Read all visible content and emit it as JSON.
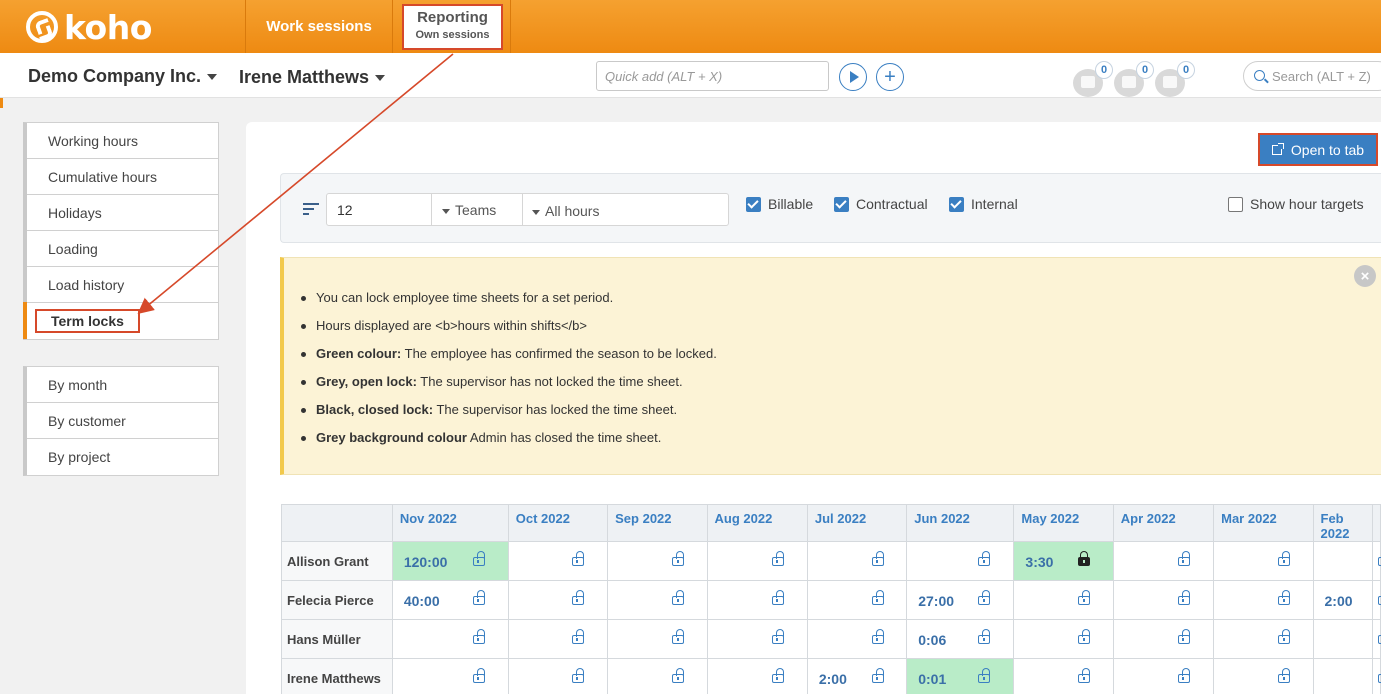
{
  "app": {
    "brand": "koho",
    "nav": {
      "work_sessions": "Work sessions",
      "reporting": "Reporting",
      "reporting_sub": "Own sessions"
    }
  },
  "subbar": {
    "company": "Demo Company Inc.",
    "person": "Irene Matthews",
    "quick_add_placeholder": "Quick add (ALT + X)",
    "notifications": [
      "0",
      "0",
      "0"
    ],
    "search_placeholder": "Search (ALT + Z)"
  },
  "sidebar": {
    "group1": [
      "Working hours",
      "Cumulative hours",
      "Holidays",
      "Loading",
      "Load history",
      "Term locks"
    ],
    "group2": [
      "By month",
      "By customer",
      "By project"
    ]
  },
  "toolbar": {
    "open_to_tab": "Open to tab",
    "count": "12",
    "teams": "Teams",
    "hours": "All hours",
    "checkboxes": {
      "billable": "Billable",
      "contractual": "Contractual",
      "internal": "Internal",
      "show_targets": "Show hour targets"
    }
  },
  "info": {
    "close": "×",
    "items": [
      {
        "bold": "",
        "text": "You can lock employee time sheets for a set period."
      },
      {
        "bold": "",
        "text": "Hours displayed are <b>hours within shifts</b>"
      },
      {
        "bold": "Green colour:",
        "text": " The employee has confirmed the season to be locked."
      },
      {
        "bold": "Grey, open lock:",
        "text": " The supervisor has not locked the time sheet."
      },
      {
        "bold": "Black, closed lock:",
        "text": " The supervisor has locked the time sheet."
      },
      {
        "bold": "Grey background colour",
        "text": " Admin has closed the time sheet."
      }
    ]
  },
  "table": {
    "columns": [
      "Nov 2022",
      "Oct 2022",
      "Sep 2022",
      "Aug 2022",
      "Jul 2022",
      "Jun 2022",
      "May 2022",
      "Apr 2022",
      "Mar 2022",
      "Feb 2022"
    ],
    "rows": [
      {
        "name": "Allison Grant",
        "cells": [
          {
            "v": "120:00",
            "green": true
          },
          {
            "v": ""
          },
          {
            "v": ""
          },
          {
            "v": ""
          },
          {
            "v": ""
          },
          {
            "v": ""
          },
          {
            "v": "3:30",
            "green": true,
            "closed": true
          },
          {
            "v": ""
          },
          {
            "v": ""
          },
          {
            "v": ""
          }
        ]
      },
      {
        "name": "Felecia Pierce",
        "cells": [
          {
            "v": "40:00"
          },
          {
            "v": ""
          },
          {
            "v": ""
          },
          {
            "v": ""
          },
          {
            "v": ""
          },
          {
            "v": "27:00"
          },
          {
            "v": ""
          },
          {
            "v": ""
          },
          {
            "v": ""
          },
          {
            "v": "2:00"
          }
        ]
      },
      {
        "name": "Hans Müller",
        "cells": [
          {
            "v": ""
          },
          {
            "v": ""
          },
          {
            "v": ""
          },
          {
            "v": ""
          },
          {
            "v": ""
          },
          {
            "v": "0:06"
          },
          {
            "v": ""
          },
          {
            "v": ""
          },
          {
            "v": ""
          },
          {
            "v": ""
          }
        ]
      },
      {
        "name": "Irene Matthews",
        "cells": [
          {
            "v": ""
          },
          {
            "v": ""
          },
          {
            "v": ""
          },
          {
            "v": ""
          },
          {
            "v": "2:00"
          },
          {
            "v": "0:01",
            "green": true
          },
          {
            "v": ""
          },
          {
            "v": ""
          },
          {
            "v": ""
          },
          {
            "v": ""
          }
        ]
      }
    ]
  },
  "colors": {
    "brand_orange": "#ee8a12",
    "accent_blue": "#3a7fc2",
    "confirmed_green": "#b9ecc8",
    "annotation_red": "#d6492a"
  }
}
